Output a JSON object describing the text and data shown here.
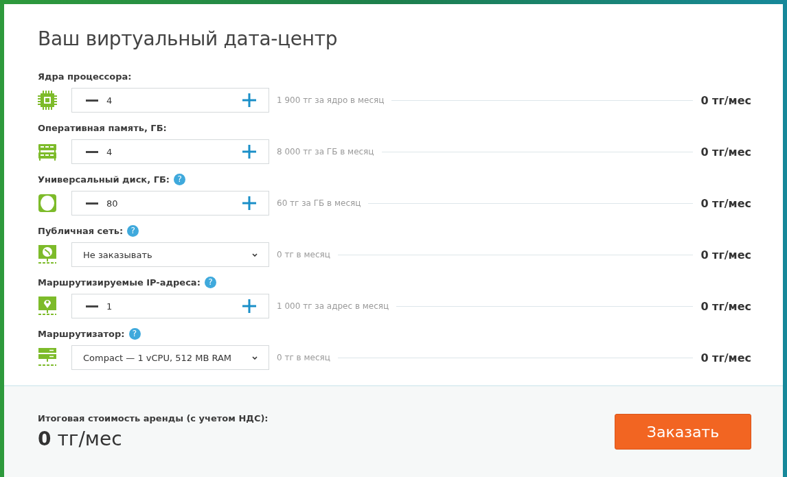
{
  "title": "Ваш виртуальный дата-центр",
  "rows": [
    {
      "label": "Ядра процессора:",
      "kind": "stepper",
      "value": "4",
      "note": "1 900 тг за ядро в месяц",
      "total": "0 тг/мес"
    },
    {
      "label": "Оперативная память, ГБ:",
      "kind": "stepper",
      "value": "4",
      "note": "8 000 тг за ГБ в месяц",
      "total": "0 тг/мес"
    },
    {
      "label": "Универсальный диск, ГБ:",
      "help": "?",
      "kind": "stepper",
      "value": "80",
      "note": "60 тг за ГБ в месяц",
      "total": "0 тг/мес"
    },
    {
      "label": "Публичная сеть:",
      "help": "?",
      "kind": "select",
      "value": "Не заказывать",
      "note": "0 тг в месяц",
      "total": "0 тг/мес"
    },
    {
      "label": "Маршрутизируемые IP-адреса:",
      "help": "?",
      "kind": "stepper",
      "value": "1",
      "note": "1 000 тг за адрес в месяц",
      "total": "0 тг/мес"
    },
    {
      "label": "Маршрутизатор:",
      "help": "?",
      "kind": "select",
      "value": "Compact — 1 vCPU, 512 MB RAM",
      "note": "0 тг в месяц",
      "total": "0 тг/мес"
    }
  ],
  "footer": {
    "label": "Итоговая стоимость аренды (с учетом НДС):",
    "total": "**0** тг/мес",
    "button": "Заказать"
  }
}
